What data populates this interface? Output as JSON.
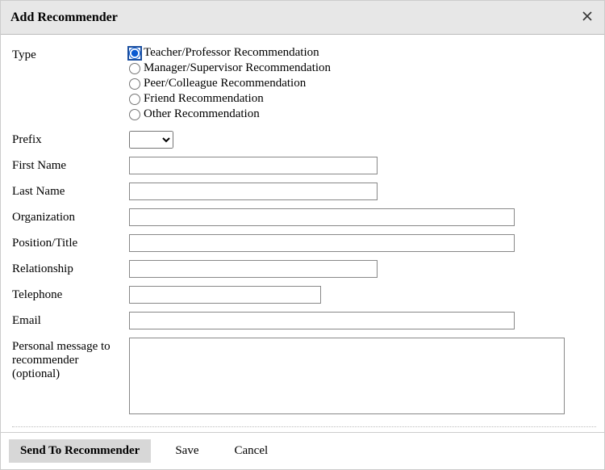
{
  "modal": {
    "title": "Add Recommender"
  },
  "form": {
    "type": {
      "label": "Type",
      "options": [
        {
          "label": "Teacher/Professor Recommendation",
          "selected": true
        },
        {
          "label": "Manager/Supervisor Recommendation",
          "selected": false
        },
        {
          "label": "Peer/Colleague Recommendation",
          "selected": false
        },
        {
          "label": "Friend Recommendation",
          "selected": false
        },
        {
          "label": "Other Recommendation",
          "selected": false
        }
      ]
    },
    "prefix": {
      "label": "Prefix",
      "value": ""
    },
    "first_name": {
      "label": "First Name",
      "value": ""
    },
    "last_name": {
      "label": "Last Name",
      "value": ""
    },
    "organization": {
      "label": "Organization",
      "value": ""
    },
    "position": {
      "label": "Position/Title",
      "value": ""
    },
    "relationship": {
      "label": "Relationship",
      "value": ""
    },
    "telephone": {
      "label": "Telephone",
      "value": ""
    },
    "email": {
      "label": "Email",
      "value": ""
    },
    "message": {
      "label": "Personal message to recommender (optional)",
      "value": ""
    }
  },
  "buttons": {
    "send": "Send To Recommender",
    "save": "Save",
    "cancel": "Cancel"
  }
}
